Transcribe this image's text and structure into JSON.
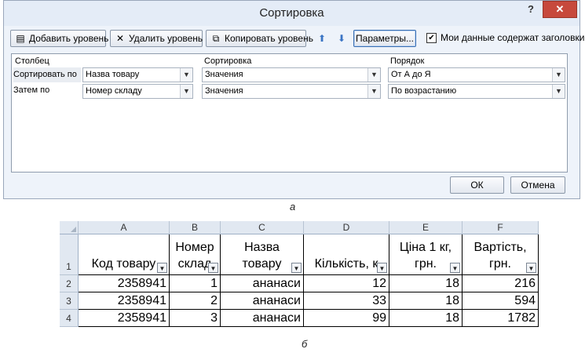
{
  "dialog": {
    "title": "Сортировка",
    "help": "?",
    "close": "✕",
    "toolbar": {
      "add": "Добавить уровень",
      "delete": "Удалить уровень",
      "copy": "Копировать уровень",
      "up": "⬆",
      "down": "⬇",
      "params": "Параметры...",
      "headers_checkbox": "Мои данные содержат заголовки",
      "headers_checked": "✔"
    },
    "columns": {
      "column": "Столбец",
      "sort": "Сортировка",
      "order": "Порядок"
    },
    "rows": [
      {
        "label": "Сортировать по",
        "column": "Назва товару",
        "sort_on": "Значения",
        "order": "От А до Я"
      },
      {
        "label": "Затем по",
        "column": "Номер складу",
        "sort_on": "Значения",
        "order": "По возрастанию"
      }
    ],
    "ok": "ОК",
    "cancel": "Отмена"
  },
  "captions": {
    "a": "а",
    "b": "б"
  },
  "sheet": {
    "col_letters": [
      "A",
      "B",
      "C",
      "D",
      "E",
      "F"
    ],
    "row_numbers": [
      "1",
      "2",
      "3",
      "4"
    ],
    "headers": [
      [
        "Код товару"
      ],
      [
        "Номер",
        "склад"
      ],
      [
        "Назва",
        "товару"
      ],
      [
        "Кількість, к"
      ],
      [
        "Ціна 1 кг,",
        "грн."
      ],
      [
        "Вартість,",
        "грн."
      ]
    ],
    "filter_glyphs": [
      "▼",
      "▼",
      "▼",
      "▼",
      "▼",
      "▼"
    ],
    "rows": [
      [
        "2358941",
        "1",
        "ананаси",
        "12",
        "18",
        "216"
      ],
      [
        "2358941",
        "2",
        "ананаси",
        "33",
        "18",
        "594"
      ],
      [
        "2358941",
        "3",
        "ананаси",
        "99",
        "18",
        "1782"
      ]
    ]
  }
}
